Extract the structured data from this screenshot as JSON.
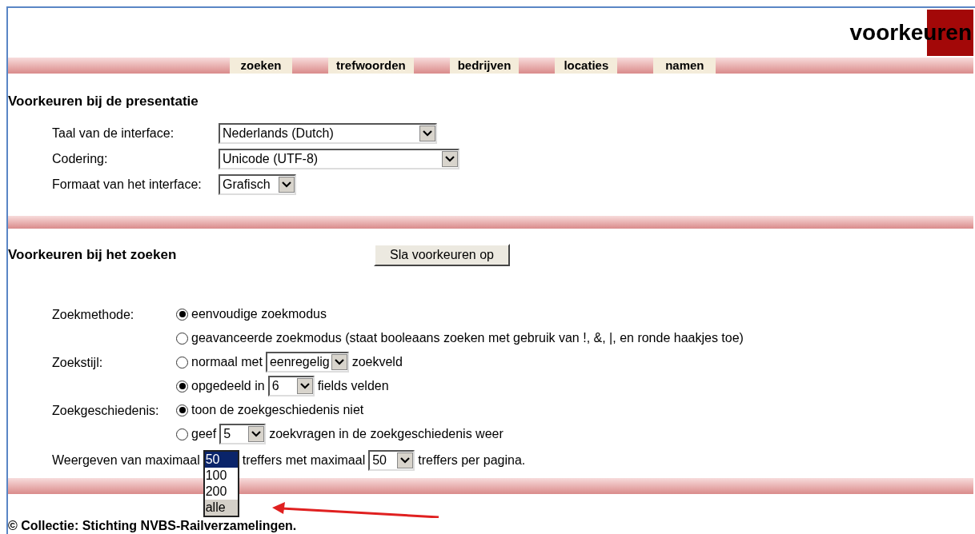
{
  "header": {
    "title": "voorkeuren"
  },
  "nav": [
    {
      "label": "zoeken"
    },
    {
      "label": "trefwoorden"
    },
    {
      "label": "bedrijven"
    },
    {
      "label": "locaties"
    },
    {
      "label": "namen"
    }
  ],
  "presentation": {
    "heading": "Voorkeuren bij de presentatie",
    "rows": [
      {
        "label": "Taal van de interface:",
        "value": "Nederlands (Dutch)"
      },
      {
        "label": "Codering:",
        "value": "Unicode (UTF-8)"
      },
      {
        "label": "Formaat van het interface:",
        "value": "Grafisch"
      }
    ]
  },
  "search": {
    "heading": "Voorkeuren bij het zoeken",
    "save_button": "Sla voorkeuren op",
    "groups": [
      {
        "label": "Zoekmethode:",
        "options": [
          {
            "selected": true,
            "parts": [
              {
                "kind": "text",
                "text": "eenvoudige zoekmodus"
              }
            ]
          },
          {
            "selected": false,
            "parts": [
              {
                "kind": "text",
                "text": "geavanceerde zoekmodus (staat booleaans zoeken met gebruik van !, &, |, en ronde haakjes toe)"
              }
            ]
          }
        ]
      },
      {
        "label": "Zoekstijl:",
        "options": [
          {
            "selected": false,
            "parts": [
              {
                "kind": "text",
                "text": "normaal met"
              },
              {
                "kind": "select",
                "value": "eenregelig"
              },
              {
                "kind": "text",
                "text": "zoekveld"
              }
            ]
          },
          {
            "selected": true,
            "parts": [
              {
                "kind": "text",
                "text": "opgedeeld in"
              },
              {
                "kind": "select",
                "value": "6"
              },
              {
                "kind": "text",
                "text": "fields velden"
              }
            ]
          }
        ]
      },
      {
        "label": "Zoekgeschiedenis:",
        "options": [
          {
            "selected": true,
            "parts": [
              {
                "kind": "text",
                "text": "toon de zoekgeschiedenis niet"
              }
            ]
          },
          {
            "selected": false,
            "parts": [
              {
                "kind": "text",
                "text": "geef"
              },
              {
                "kind": "select",
                "value": "5"
              },
              {
                "kind": "text",
                "text": "zoekvragen in de zoekgeschiedenis weer"
              }
            ]
          }
        ]
      }
    ],
    "limits": [
      {
        "kind": "text",
        "text": "Weergeven van maximaal"
      },
      {
        "kind": "open_select",
        "options": [
          {
            "label": "50",
            "selected": true,
            "hovered": false
          },
          {
            "label": "100",
            "selected": false,
            "hovered": false
          },
          {
            "label": "200",
            "selected": false,
            "hovered": false
          },
          {
            "label": "alle",
            "selected": false,
            "hovered": true
          }
        ]
      },
      {
        "kind": "text",
        "text": "treffers met maximaal"
      },
      {
        "kind": "select",
        "value": "50"
      },
      {
        "kind": "text",
        "text": "treffers per pagina."
      }
    ]
  },
  "footer": "© Collectie: Stichting NVBS-Railverzamelingen."
}
